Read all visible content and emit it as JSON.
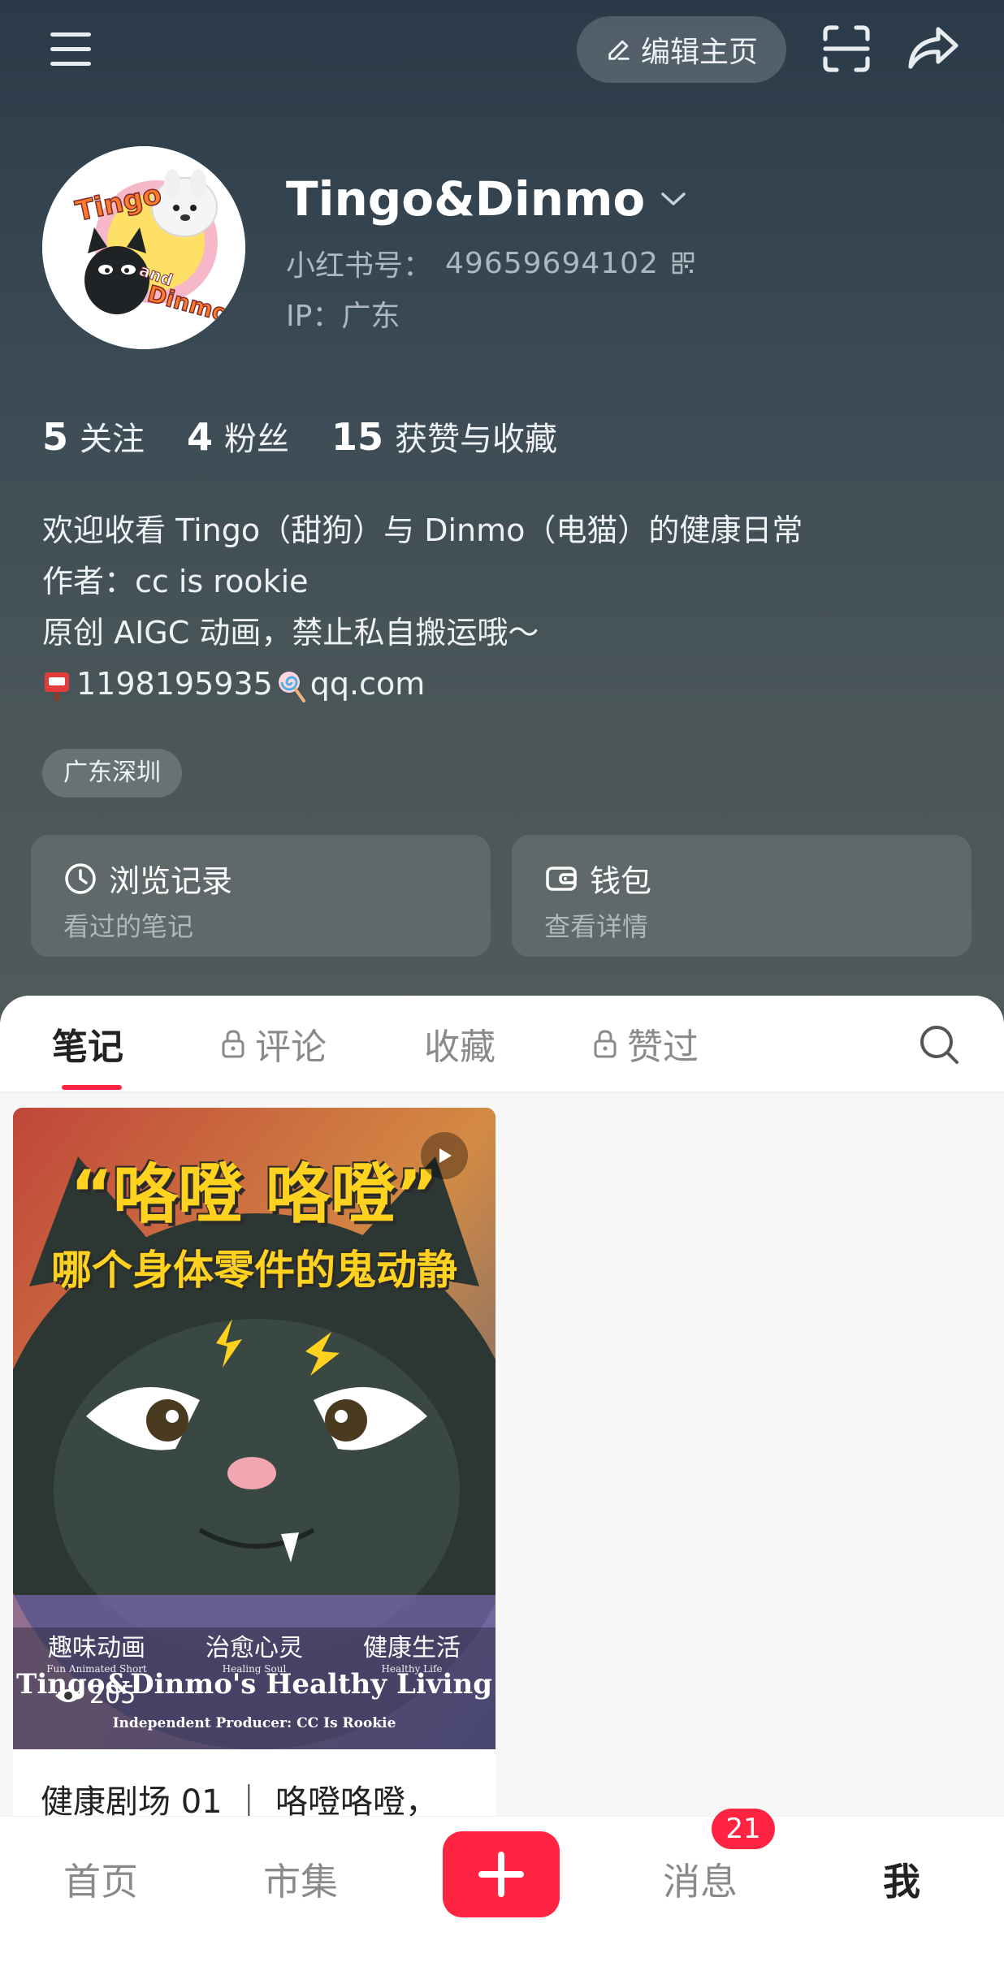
{
  "header": {
    "edit_label": "编辑主页",
    "username": "Tingo&Dinmo",
    "red_id_label": "小红书号：",
    "red_id": "49659694102",
    "ip_label": "IP：",
    "ip_value": "广东"
  },
  "avatar": {
    "text_tingo": "Tingo",
    "text_and": "and",
    "text_dinmo": "Dinmo"
  },
  "stats": [
    {
      "num": "5",
      "label": "关注"
    },
    {
      "num": "4",
      "label": "粉丝"
    },
    {
      "num": "15",
      "label": "获赞与收藏"
    }
  ],
  "bio": {
    "line1": "欢迎收看 Tingo（甜狗）与 Dinmo（电猫）的健康日常",
    "line2": "作者：cc is rookie",
    "line3": "原创 AIGC 动画，禁止私自搬运哦～",
    "line4_part1": "1198195935",
    "line4_part2": "qq.com"
  },
  "tag": "广东深圳",
  "cards": [
    {
      "title": "浏览记录",
      "subtitle": "看过的笔记",
      "icon": "clock-icon"
    },
    {
      "title": "钱包",
      "subtitle": "查看详情",
      "icon": "wallet-icon"
    }
  ],
  "tabs": [
    {
      "label": "笔记",
      "locked": false,
      "active": true
    },
    {
      "label": "评论",
      "locked": true,
      "active": false
    },
    {
      "label": "收藏",
      "locked": false,
      "active": false
    },
    {
      "label": "赞过",
      "locked": true,
      "active": false
    }
  ],
  "note": {
    "cover_title1": "“咯噔 咯噔”",
    "cover_title2": "哪个身体零件的鬼动静",
    "awards": [
      {
        "main": "趣味动画",
        "sub": "Fun Animated Short"
      },
      {
        "main": "治愈心灵",
        "sub": "Healing Soul"
      },
      {
        "main": "健康生活",
        "sub": "Healthy Life"
      }
    ],
    "cover_subtitle": "Tingo&Dinmo's Healthy Living",
    "cover_credit": "Independent Producer: CC Is Rookie",
    "views": "205",
    "title": "健康剧场 01 ｜ 咯噔咯噔，"
  },
  "bottom_nav": {
    "items": [
      "首页",
      "市集",
      "消息",
      "我"
    ],
    "messages_badge": "21"
  },
  "colors": {
    "accent": "#ff2442",
    "header_top": "#2a3a48",
    "header_bottom": "#505a5a",
    "cover_yellow": "#ffd21f"
  }
}
